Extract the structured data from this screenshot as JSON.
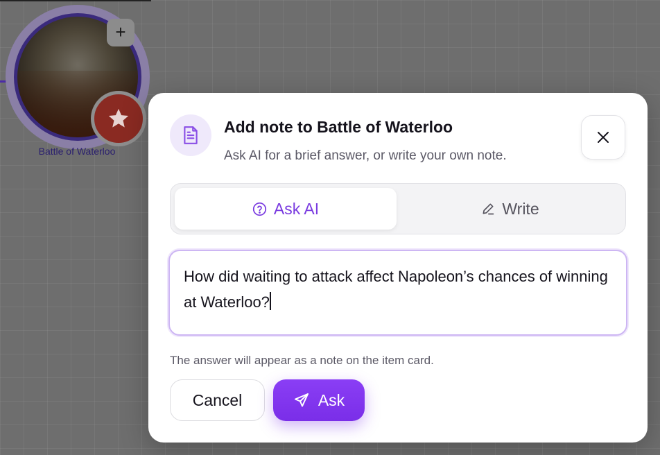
{
  "canvas": {
    "node": {
      "label": "Battle of Waterloo",
      "plus_glyph": "+"
    }
  },
  "dialog": {
    "title": "Add note to Battle of Waterloo",
    "subtitle": "Ask AI for a brief answer, or write your own note.",
    "tabs": [
      {
        "label": "Ask AI",
        "icon": "question-circle-icon",
        "active": true
      },
      {
        "label": "Write",
        "icon": "pencil-icon",
        "active": false
      }
    ],
    "question_value": "How did waiting to attack affect Napoleon’s chances of winning at Waterloo?",
    "hint": "The answer will appear as a note on the item card.",
    "cancel_label": "Cancel",
    "ask_label": "Ask"
  },
  "colors": {
    "accent": "#7a2ee8",
    "accent_light": "#efe9fb",
    "node_ring": "#3a2a7c",
    "star_badge": "#8a2a22"
  }
}
